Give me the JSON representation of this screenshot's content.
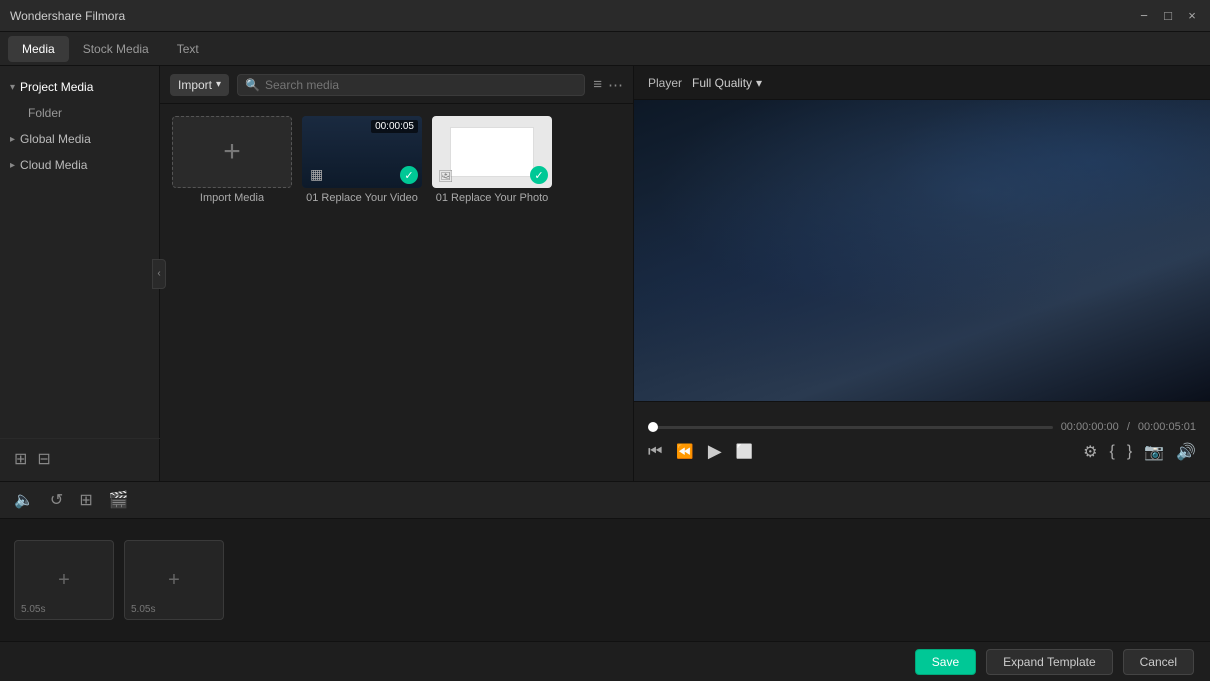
{
  "titlebar": {
    "title": "Wondershare Filmora",
    "minimize": "−",
    "maximize": "□",
    "close": "×"
  },
  "tabs": [
    {
      "id": "media",
      "label": "Media",
      "active": true
    },
    {
      "id": "stock",
      "label": "Stock Media",
      "active": false
    },
    {
      "id": "text",
      "label": "Text",
      "active": false
    }
  ],
  "sidebar": {
    "items": [
      {
        "id": "project-media",
        "label": "Project Media",
        "indent": 0,
        "arrow": "▾",
        "active": true
      },
      {
        "id": "folder",
        "label": "Folder",
        "indent": 1,
        "arrow": ""
      },
      {
        "id": "global-media",
        "label": "Global Media",
        "indent": 0,
        "arrow": "▸"
      },
      {
        "id": "cloud-media",
        "label": "Cloud Media",
        "indent": 0,
        "arrow": "▸"
      }
    ],
    "collapse_icon": "‹"
  },
  "content": {
    "import_label": "Import",
    "search_placeholder": "Search media",
    "media_items": [
      {
        "id": "import",
        "type": "import",
        "label": "Import Media"
      },
      {
        "id": "video1",
        "type": "video",
        "label": "01 Replace Your Video",
        "timestamp": "00:00:05"
      },
      {
        "id": "photo1",
        "type": "photo",
        "label": "01 Replace Your Photo"
      }
    ]
  },
  "player": {
    "label": "Player",
    "quality": "Full Quality",
    "current_time": "00:00:00:00",
    "total_time": "00:00:05:01",
    "separator": "/"
  },
  "timeline": {
    "clips": [
      {
        "id": "clip1",
        "duration": "5.05s"
      },
      {
        "id": "clip2",
        "duration": "5.05s"
      }
    ]
  },
  "actions": {
    "save_label": "Save",
    "expand_label": "Expand Template",
    "cancel_label": "Cancel"
  }
}
